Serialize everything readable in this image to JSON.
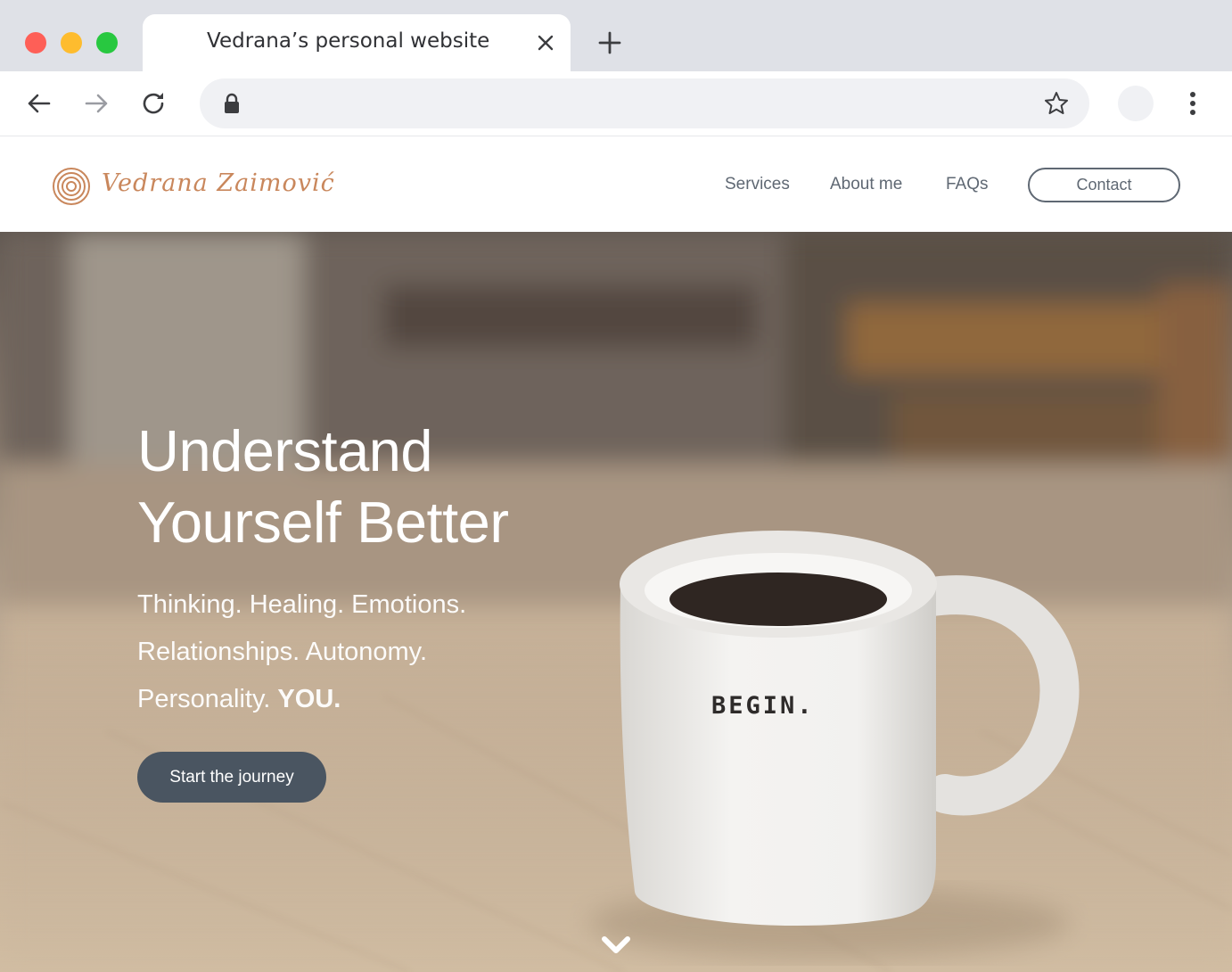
{
  "browser": {
    "tab_title": "Vedrana’s personal website",
    "address": ""
  },
  "site": {
    "logo_text": "Vedrana Zaimović",
    "nav": {
      "services": "Services",
      "about": "About me",
      "faqs": "FAQs",
      "contact": "Contact"
    }
  },
  "hero": {
    "title_line1": "Understand",
    "title_line2": "Yourself Better",
    "line1": "Thinking. Healing. Emotions.",
    "line2": "Relationships. Autonomy.",
    "line3_prefix": "Personality. ",
    "line3_bold": "YOU.",
    "cta": "Start the journey",
    "mug_text": "BEGIN."
  },
  "colors": {
    "brand_accent": "#c9875c",
    "nav_text": "#5f6873",
    "cta_bg": "#4a5561",
    "tabstrip_bg": "#dfe1e7"
  },
  "icons": {
    "back": "back-arrow-icon",
    "forward": "forward-arrow-icon",
    "reload": "reload-icon",
    "lock": "lock-icon",
    "star": "star-icon",
    "menu": "kebab-menu-icon",
    "close": "close-icon",
    "new_tab": "plus-icon",
    "logo": "spiral-logo-icon",
    "scroll": "chevron-down-icon"
  }
}
